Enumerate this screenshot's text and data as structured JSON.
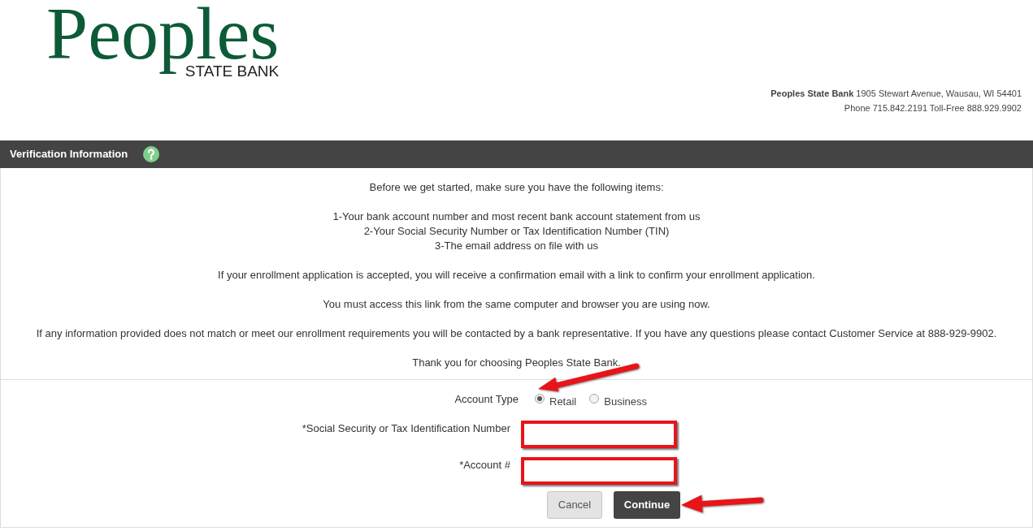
{
  "logo": {
    "name": "Peoples",
    "tagline": "STATE BANK"
  },
  "contact": {
    "address_line": "**Peoples State Bank** 1905 Stewart Avenue, Wausau, WI 54401",
    "phone_line": "Phone 715.842.2191 Toll-Free 888.929.9902"
  },
  "section": {
    "title": "Verification Information"
  },
  "intro": {
    "heading": "Before we get started, make sure you have the following items:",
    "items": [
      "1-Your bank account number and most recent bank account statement from us",
      "2-Your Social Security Number or Tax Identification Number (TIN)",
      "3-The email address on file with us"
    ],
    "paragraphs": [
      "If your enrollment application is accepted, you will receive a confirmation email with a link to confirm your enrollment application.",
      "You must access this link from the same computer and browser you are using now.",
      "If any information provided does not match or meet our enrollment requirements you will be contacted by a bank representative. If you have any questions please contact Customer Service at 888-929-9902.",
      "Thank you for choosing Peoples State Bank."
    ]
  },
  "form": {
    "account_type": {
      "label": "Account Type",
      "options": [
        {
          "label": "Retail",
          "selected": true
        },
        {
          "label": "Business",
          "selected": false
        }
      ]
    },
    "fields": [
      {
        "label": "*Social Security or Tax Identification Number"
      },
      {
        "label": "*Account #"
      }
    ]
  },
  "buttons": [
    {
      "label": "Cancel",
      "kind": "secondary"
    },
    {
      "label": "Continue",
      "kind": "primary"
    }
  ]
}
